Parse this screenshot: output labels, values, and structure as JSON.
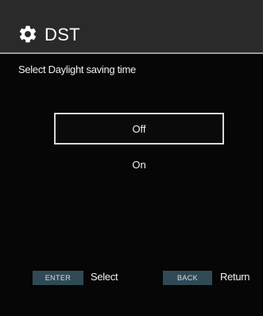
{
  "header": {
    "icon": "gear-icon",
    "title": "DST"
  },
  "prompt": "Select Daylight saving time",
  "options": [
    {
      "label": "Off",
      "selected": true
    },
    {
      "label": "On",
      "selected": false
    }
  ],
  "footer": {
    "enter_key": "ENTER",
    "enter_action": "Select",
    "back_key": "BACK",
    "back_action": "Return"
  },
  "colors": {
    "background": "#060606",
    "header_background": "#2a2a2a",
    "key_badge": "#2f4a55",
    "selection_border": "#d8d8d8"
  }
}
